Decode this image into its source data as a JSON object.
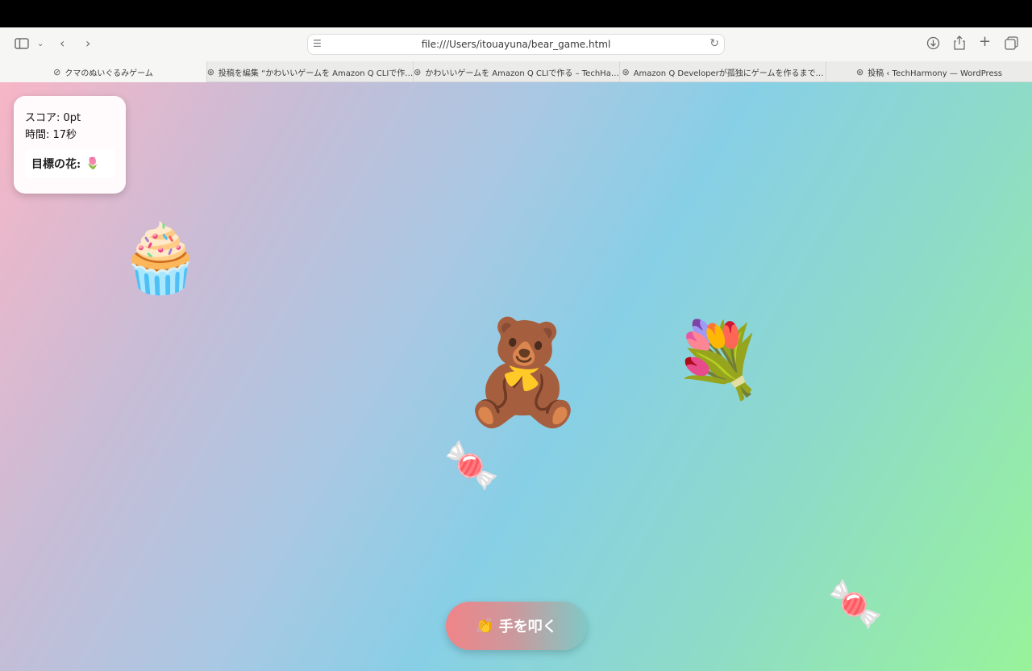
{
  "browser": {
    "url": "file:///Users/itouayuna/bear_game.html",
    "tabs": [
      {
        "label": "クマのぬいぐるみゲーム",
        "icon": "compass-icon",
        "active": true
      },
      {
        "label": "投稿を編集 “かわいいゲームを Amazon Q CLIで作…",
        "icon": "wordpress-icon",
        "active": false
      },
      {
        "label": "かわいいゲームを Amazon Q CLIで作る – TechHa…",
        "icon": "wordpress-icon",
        "active": false
      },
      {
        "label": "Amazon Q Developerが孤独にゲームを作るまで…",
        "icon": "wordpress-icon",
        "active": false
      },
      {
        "label": "投稿 ‹ TechHarmony — WordPress",
        "icon": "wordpress-icon",
        "active": false
      }
    ]
  },
  "game": {
    "score_text": "スコア: 0pt",
    "time_text": "時間: 17秒",
    "target_label": "目標の花:",
    "target_flower": "🌷",
    "items": {
      "cupcake": "🧁",
      "bear": "🧸",
      "bouquet": "💐",
      "candy": "🍬"
    },
    "clap_icon": "👏",
    "clap_label": "手を叩く"
  },
  "colors": {
    "gradient_start": "#f7b6c6",
    "gradient_mid": "#87cfe6",
    "gradient_end": "#98f39a",
    "button_start": "#f08488",
    "button_end": "#7fc9c6"
  }
}
